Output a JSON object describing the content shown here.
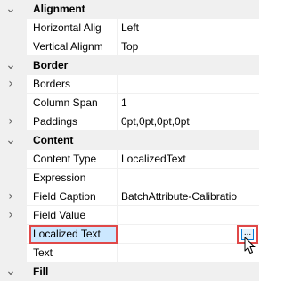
{
  "property_grid": {
    "categories": {
      "alignment": "Alignment",
      "border": "Border",
      "content": "Content",
      "fill": "Fill"
    },
    "rows": {
      "horizontal_alignment": {
        "name": "Horizontal Alig",
        "value": "Left"
      },
      "vertical_alignment": {
        "name": "Vertical Alignm",
        "value": "Top"
      },
      "borders": {
        "name": "Borders",
        "value": ""
      },
      "column_span": {
        "name": "Column Span",
        "value": "1"
      },
      "paddings": {
        "name": "Paddings",
        "value": "0pt,0pt,0pt,0pt"
      },
      "content_type": {
        "name": "Content Type",
        "value": "LocalizedText"
      },
      "expression": {
        "name": "Expression",
        "value": ""
      },
      "field_caption": {
        "name": "Field Caption",
        "value": "BatchAttribute-Calibratio"
      },
      "field_value": {
        "name": "Field Value",
        "value": ""
      },
      "localized_text": {
        "name": "Localized Text",
        "value": ""
      },
      "text": {
        "name": "Text",
        "value": ""
      }
    },
    "icons": {
      "expanded": "chevron-down-icon",
      "collapsed": "chevron-right-icon",
      "cursor": "mouse-pointer-icon"
    },
    "ellipsis_button_label": "...",
    "colors": {
      "highlight": "#e04848",
      "selection": "#cce8ff",
      "gutter": "#f0f0f0",
      "button_border": "#0078d7"
    }
  }
}
